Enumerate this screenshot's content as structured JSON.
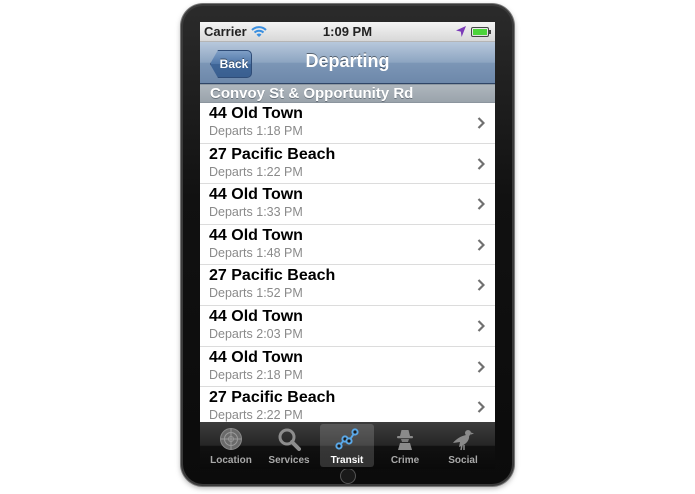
{
  "status_bar": {
    "carrier": "Carrier",
    "time": "1:09 PM"
  },
  "nav": {
    "back_label": "Back",
    "title": "Departing"
  },
  "section": {
    "title": "Convoy St & Opportunity Rd"
  },
  "departures": [
    {
      "route": "44 Old Town",
      "departs": "Departs 1:18 PM"
    },
    {
      "route": "27 Pacific Beach",
      "departs": "Departs 1:22 PM"
    },
    {
      "route": "44 Old Town",
      "departs": "Departs 1:33 PM"
    },
    {
      "route": "44 Old Town",
      "departs": "Departs 1:48 PM"
    },
    {
      "route": "27 Pacific Beach",
      "departs": "Departs 1:52 PM"
    },
    {
      "route": "44 Old Town",
      "departs": "Departs 2:03 PM"
    },
    {
      "route": "44 Old Town",
      "departs": "Departs 2:18 PM"
    },
    {
      "route": "27 Pacific Beach",
      "departs": "Departs 2:22 PM"
    }
  ],
  "tabs": [
    {
      "label": "Location",
      "icon": "radar-icon",
      "selected": false
    },
    {
      "label": "Services",
      "icon": "magnifier-icon",
      "selected": false
    },
    {
      "label": "Transit",
      "icon": "transit-route-icon",
      "selected": true
    },
    {
      "label": "Crime",
      "icon": "detective-icon",
      "selected": false
    },
    {
      "label": "Social",
      "icon": "pigeon-icon",
      "selected": false
    }
  ],
  "colors": {
    "nav_bar": "#8da5c1",
    "section_header": "#a3acb4",
    "tab_bar": "#1c1c1c",
    "battery": "#4cd43a",
    "transit_accent": "#5aa8e8"
  }
}
